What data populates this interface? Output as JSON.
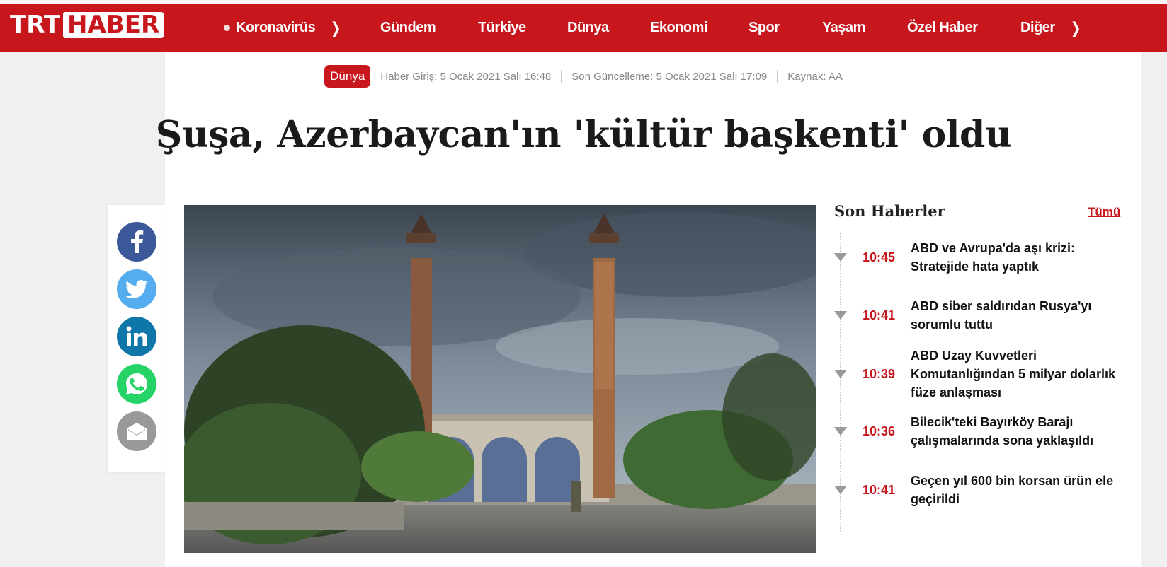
{
  "brand": {
    "logo_left": "TRT",
    "logo_right": "HABER",
    "red": "#c8161d"
  },
  "nav": {
    "items": [
      {
        "label": "Koronavirüs",
        "has_dot": true,
        "has_chevron": true
      },
      {
        "label": "Gündem"
      },
      {
        "label": "Türkiye"
      },
      {
        "label": "Dünya"
      },
      {
        "label": "Ekonomi"
      },
      {
        "label": "Spor"
      },
      {
        "label": "Yaşam"
      },
      {
        "label": "Özel Haber"
      },
      {
        "label": "Diğer",
        "has_chevron": true
      }
    ]
  },
  "article": {
    "category": "Dünya",
    "published": "Haber Giriş: 5 Ocak 2021 Salı 16:48",
    "updated": "Son Güncelleme: 5 Ocak 2021 Salı 17:09",
    "source": "Kaynak: AA",
    "title": "Şuşa, Azerbaycan'ın 'kültür başkenti' oldu"
  },
  "share": {
    "icons": [
      "facebook-icon",
      "twitter-icon",
      "linkedin-icon",
      "whatsapp-icon",
      "email-icon"
    ],
    "colors": {
      "facebook": "#3b5998",
      "twitter": "#55acee",
      "linkedin": "#0e76a8",
      "whatsapp": "#25d366",
      "email": "#999999"
    }
  },
  "sidebar": {
    "title": "Son Haberler",
    "all_link": "Tümü",
    "items": [
      {
        "time": "10:45",
        "text": "ABD ve Avrupa'da aşı krizi: Stratejide hata yaptık"
      },
      {
        "time": "10:41",
        "text": "ABD siber saldırıdan Rusya'yı sorumlu tuttu"
      },
      {
        "time": "10:39",
        "text": "ABD Uzay Kuvvetleri Komutanlığından 5 milyar dolarlık füze anlaşması"
      },
      {
        "time": "10:36",
        "text": "Bilecik'teki Bayırköy Barajı çalışmalarında sona yaklaşıldı"
      },
      {
        "time": "10:41",
        "text": "Geçen yıl 600 bin korsan ürün ele geçirildi"
      }
    ]
  }
}
